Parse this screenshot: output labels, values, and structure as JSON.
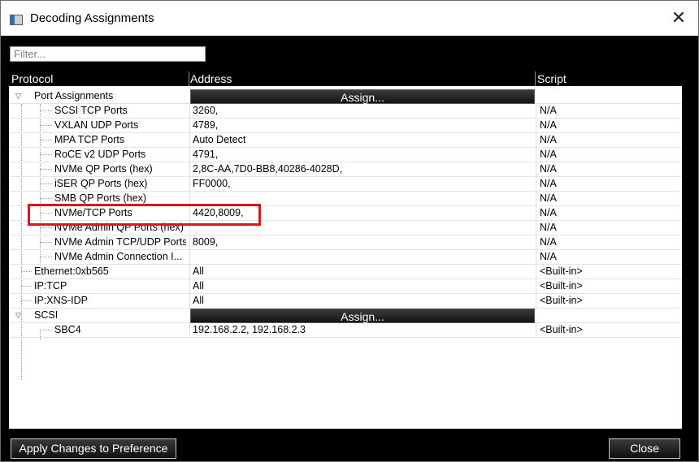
{
  "window": {
    "title": "Decoding Assignments"
  },
  "filter": {
    "placeholder": "Filter...",
    "value": ""
  },
  "columns": {
    "protocol": "Protocol",
    "address": "Address",
    "script": "Script"
  },
  "groups": {
    "port_assignments": {
      "label": "Port Assignments",
      "assign_label": "Assign..."
    },
    "scsi": {
      "label": "SCSI",
      "assign_label": "Assign..."
    }
  },
  "port_rows": [
    {
      "protocol": "SCSI TCP Ports",
      "address": "3260,",
      "script": "N/A"
    },
    {
      "protocol": "VXLAN UDP Ports",
      "address": "4789,",
      "script": "N/A"
    },
    {
      "protocol": "MPA TCP Ports",
      "address": "Auto Detect",
      "script": "N/A"
    },
    {
      "protocol": "RoCE v2 UDP Ports",
      "address": "4791,",
      "script": "N/A"
    },
    {
      "protocol": "NVMe QP Ports (hex)",
      "address": "2,8C-AA,7D0-BB8,40286-4028D,",
      "script": "N/A"
    },
    {
      "protocol": "iSER QP Ports (hex)",
      "address": "FF0000,",
      "script": "N/A"
    },
    {
      "protocol": "SMB QP Ports (hex)",
      "address": "",
      "script": "N/A"
    },
    {
      "protocol": "NVMe/TCP Ports",
      "address": "4420,8009,",
      "script": "N/A"
    },
    {
      "protocol": "NVMe Admin QP Ports (hex)",
      "address": "",
      "script": "N/A"
    },
    {
      "protocol": "NVMe Admin TCP/UDP Ports",
      "address": "8009,",
      "script": "N/A"
    },
    {
      "protocol": "NVMe Admin Connection I...",
      "address": "",
      "script": "N/A"
    }
  ],
  "top_rows": [
    {
      "protocol": "Ethernet:0xb565",
      "address": "All",
      "script": "<Built-in>"
    },
    {
      "protocol": "IP:TCP",
      "address": "All",
      "script": "<Built-in>"
    },
    {
      "protocol": "IP:XNS-IDP",
      "address": "All",
      "script": "<Built-in>"
    }
  ],
  "scsi_rows": [
    {
      "protocol": "SBC4",
      "address": "192.168.2.2, 192.168.2.3",
      "script": "<Built-in>"
    }
  ],
  "buttons": {
    "apply": "Apply Changes to Preference",
    "close": "Close"
  },
  "icons": {
    "expanded": "triangle-down-icon",
    "app": "window-icon",
    "close": "close-icon"
  },
  "colors": {
    "highlight_box": "#e2141b",
    "header_bg": "#000000"
  }
}
